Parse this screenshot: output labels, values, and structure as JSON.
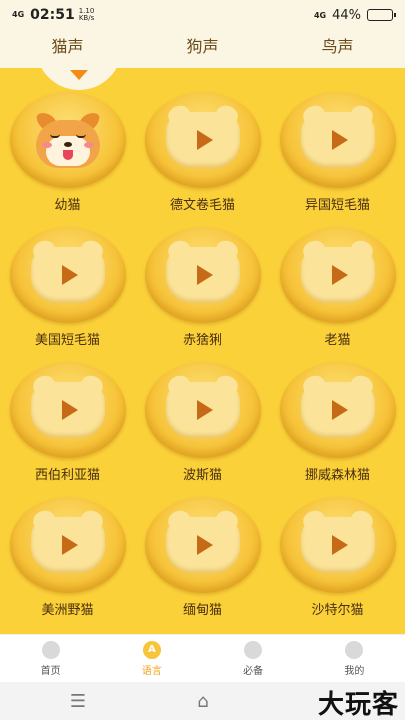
{
  "status_bar": {
    "network": "4G",
    "time": "02:51",
    "speed_value": "1.10",
    "speed_unit": "KB/s",
    "signal": "4G",
    "battery": "44%",
    "battery_level": 0.44
  },
  "tabs": [
    {
      "label": "猫声",
      "active": true
    },
    {
      "label": "狗声",
      "active": false
    },
    {
      "label": "鸟声",
      "active": false
    }
  ],
  "items": [
    {
      "label": "幼猫",
      "icon": "shiba-face-icon"
    },
    {
      "label": "德文卷毛猫",
      "icon": "play-icon"
    },
    {
      "label": "异国短毛猫",
      "icon": "play-icon"
    },
    {
      "label": "美国短毛猫",
      "icon": "play-icon"
    },
    {
      "label": "赤猞猁",
      "icon": "play-icon"
    },
    {
      "label": "老猫",
      "icon": "play-icon"
    },
    {
      "label": "西伯利亚猫",
      "icon": "play-icon"
    },
    {
      "label": "波斯猫",
      "icon": "play-icon"
    },
    {
      "label": "挪威森林猫",
      "icon": "play-icon"
    },
    {
      "label": "美洲野猫",
      "icon": "play-icon"
    },
    {
      "label": "缅甸猫",
      "icon": "play-icon"
    },
    {
      "label": "沙特尔猫",
      "icon": "play-icon"
    }
  ],
  "bottom_nav": [
    {
      "label": "首页",
      "glyph": "",
      "active": false
    },
    {
      "label": "语言",
      "glyph": "A",
      "active": true
    },
    {
      "label": "必备",
      "glyph": "",
      "active": false
    },
    {
      "label": "我的",
      "glyph": "",
      "active": false
    }
  ],
  "system_nav": {
    "menu_glyph": "☰",
    "home_glyph": "⌂"
  },
  "watermark": "大玩客",
  "colors": {
    "accent": "#fbd13a",
    "arrow": "#f28c16",
    "tab_bg": "#fbf6e4",
    "active_nav": "#f0a016"
  }
}
